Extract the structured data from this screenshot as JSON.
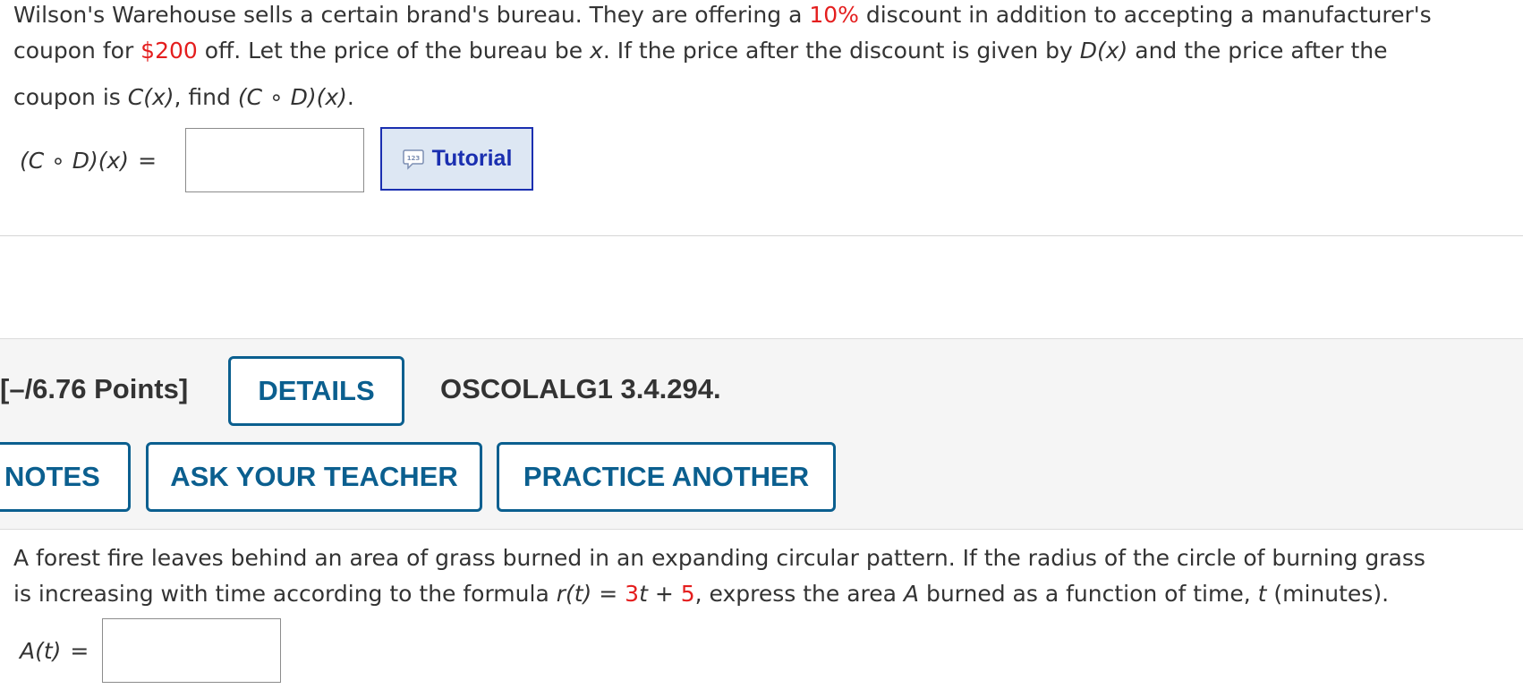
{
  "problem1": {
    "line1": {
      "a": "Wilson's Warehouse sells a certain brand's bureau. They are offering a ",
      "discount": "10%",
      "b": " discount in addition to accepting a manufacturer's"
    },
    "line2": {
      "a": "coupon for ",
      "coupon": "$200",
      "b": " off. Let the price of the bureau be ",
      "var": "x",
      "c": ". If the price after the discount is given by  ",
      "d_func": "D(x)",
      "d": "  and the price after the"
    },
    "line3": {
      "a": "coupon is  ",
      "c_func": "C(x)",
      "b": ",  find  ",
      "comp": "(C ∘ D)(x)",
      "c": "."
    },
    "answer_label": "(C ∘ D)(x)",
    "equals": "=",
    "answer_value": "",
    "tutorial_label": "Tutorial",
    "tutorial_icon_text": "123"
  },
  "problem2_header": {
    "points": "[–/6.76 Points]",
    "details_label": "DETAILS",
    "code": "OSCOLALG1 3.4.294.",
    "notes_label": "NOTES",
    "ask_teacher_label": "ASK YOUR TEACHER",
    "practice_label": "PRACTICE ANOTHER"
  },
  "problem2": {
    "line1": "A forest fire leaves behind an area of grass burned in an expanding circular pattern. If the radius of the circle of burning grass",
    "line2": {
      "a": "is increasing with time according to the formula  ",
      "r_func": "r(t)",
      "eq": " = ",
      "coef": "3",
      "t1": "t",
      "plus": " + ",
      "const": "5",
      "b": ",  express the area ",
      "area_var": "A",
      "c": " burned as a function of time, ",
      "time_var": "t",
      "d": " (minutes)."
    },
    "answer_label": "A(t)",
    "equals": "=",
    "answer_value": ""
  },
  "colors": {
    "highlight": "#e41e1e",
    "button_blue": "#0b5f8f",
    "tutorial_blue": "#1a2fb0",
    "band_gray": "#f5f5f5"
  },
  "icons": {
    "tutorial": "numbered-chat-bubble-icon"
  }
}
